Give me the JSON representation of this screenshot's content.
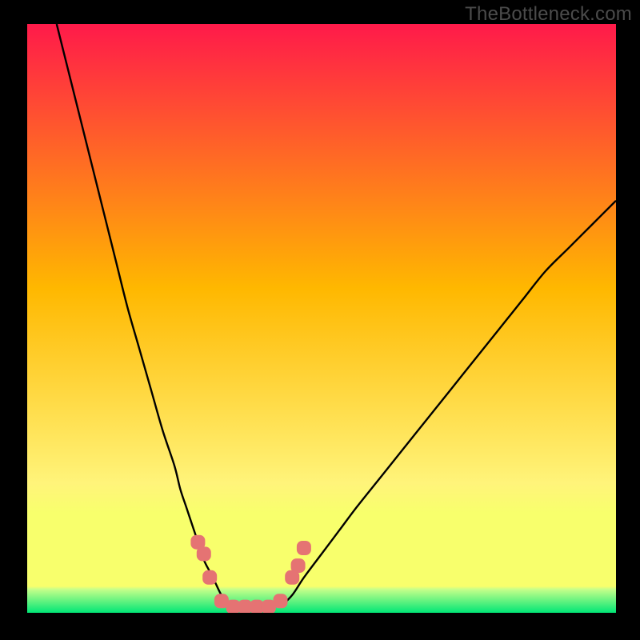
{
  "watermark": "TheBottleneck.com",
  "chart_data": {
    "type": "line",
    "title": "",
    "xlabel": "",
    "ylabel": "",
    "xlim": [
      0,
      100
    ],
    "ylim": [
      0,
      100
    ],
    "grid": false,
    "legend": false,
    "background": {
      "top_color": "#ff1a4a",
      "mid_color_upper": "#ffb800",
      "mid_color_lower": "#fff47a",
      "band_color": "#f8ff6c",
      "bottom_color": "#00e676"
    },
    "series": [
      {
        "name": "left-curve",
        "x": [
          5,
          7,
          9,
          11,
          13,
          15,
          17,
          19,
          21,
          23,
          25,
          26,
          27,
          28,
          29,
          30,
          31,
          32,
          33,
          34,
          35
        ],
        "y": [
          100,
          92,
          84,
          76,
          68,
          60,
          52,
          45,
          38,
          31,
          25,
          21,
          18,
          15,
          12,
          9,
          7,
          5,
          3,
          2,
          1
        ],
        "stroke": "#000000"
      },
      {
        "name": "right-curve",
        "x": [
          43,
          45,
          47,
          50,
          53,
          56,
          60,
          64,
          68,
          72,
          76,
          80,
          84,
          88,
          92,
          96,
          100
        ],
        "y": [
          1,
          3,
          6,
          10,
          14,
          18,
          23,
          28,
          33,
          38,
          43,
          48,
          53,
          58,
          62,
          66,
          70
        ],
        "stroke": "#000000"
      }
    ],
    "highlight_points": {
      "name": "cluster",
      "color": "#e57373",
      "points": [
        {
          "x": 29,
          "y": 12
        },
        {
          "x": 30,
          "y": 10
        },
        {
          "x": 31,
          "y": 6
        },
        {
          "x": 33,
          "y": 2
        },
        {
          "x": 35,
          "y": 1
        },
        {
          "x": 37,
          "y": 1
        },
        {
          "x": 39,
          "y": 1
        },
        {
          "x": 41,
          "y": 1
        },
        {
          "x": 43,
          "y": 2
        },
        {
          "x": 45,
          "y": 6
        },
        {
          "x": 46,
          "y": 8
        },
        {
          "x": 47,
          "y": 11
        }
      ]
    }
  }
}
